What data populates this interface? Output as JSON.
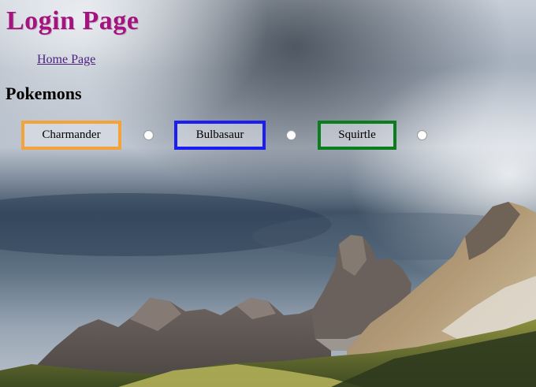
{
  "page": {
    "title": "Login Page"
  },
  "nav": {
    "home_link": "Home Page"
  },
  "section": {
    "heading": "Pokemons"
  },
  "pokemons": [
    {
      "label": "Charmander",
      "border_color": "#f4a23a",
      "radio_selected": false
    },
    {
      "label": "Bulbasaur",
      "border_color": "#1b1ef0",
      "radio_selected": false
    },
    {
      "label": "Squirtle",
      "border_color": "#0a7d1c",
      "radio_selected": false
    }
  ],
  "colors": {
    "title": "#a4147f",
    "link": "#4b1f7a"
  },
  "background": {
    "icon": "mountain-landscape-background"
  }
}
